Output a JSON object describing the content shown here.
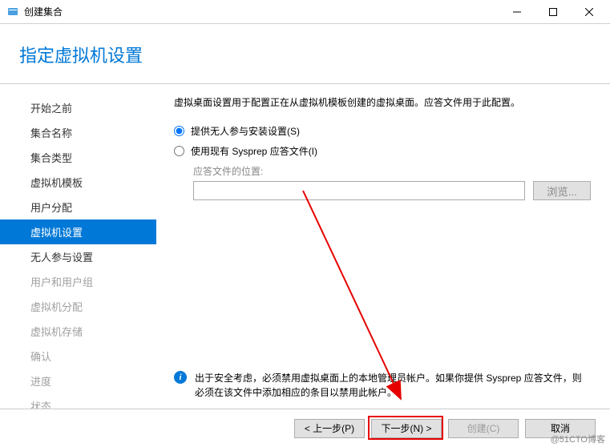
{
  "titlebar": {
    "title": "创建集合"
  },
  "header": {
    "page_title": "指定虚拟机设置"
  },
  "sidebar": {
    "items": [
      {
        "label": "开始之前",
        "state": "normal"
      },
      {
        "label": "集合名称",
        "state": "normal"
      },
      {
        "label": "集合类型",
        "state": "normal"
      },
      {
        "label": "虚拟机模板",
        "state": "normal"
      },
      {
        "label": "用户分配",
        "state": "normal"
      },
      {
        "label": "虚拟机设置",
        "state": "active"
      },
      {
        "label": "无人参与设置",
        "state": "normal"
      },
      {
        "label": "用户和用户组",
        "state": "disabled"
      },
      {
        "label": "虚拟机分配",
        "state": "disabled"
      },
      {
        "label": "虚拟机存储",
        "state": "disabled"
      },
      {
        "label": "确认",
        "state": "disabled"
      },
      {
        "label": "进度",
        "state": "disabled"
      },
      {
        "label": "状态",
        "state": "disabled"
      }
    ]
  },
  "main": {
    "description": "虚拟桌面设置用于配置正在从虚拟机模板创建的虚拟桌面。应答文件用于此配置。",
    "radio_unattended": "提供无人参与安装设置(S)",
    "radio_sysprep": "使用现有 Sysprep 应答文件(I)",
    "answer_file_label": "应答文件的位置:",
    "answer_file_value": "",
    "browse_label": "浏览...",
    "info_text": "出于安全考虑，必须禁用虚拟桌面上的本地管理员帐户。如果你提供 Sysprep 应答文件，则必须在该文件中添加相应的条目以禁用此帐户。"
  },
  "footer": {
    "prev": "< 上一步(P)",
    "next": "下一步(N) >",
    "create": "创建(C)",
    "cancel": "取消"
  },
  "watermark": "@51CTO博客"
}
